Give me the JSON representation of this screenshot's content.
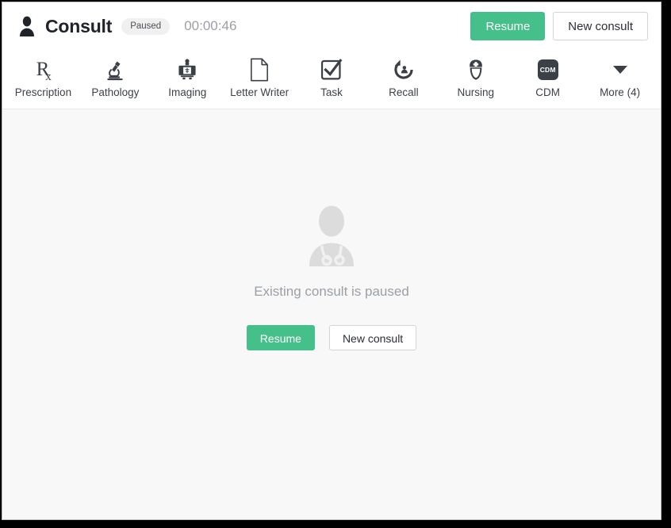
{
  "window": {
    "background_color": "#000000",
    "surface_color": "#ffffff",
    "body_color": "#f8f8f8",
    "accent_color": "#46c08a"
  },
  "header": {
    "person_icon": "person-icon",
    "title": "Consult",
    "status_badge": "Paused",
    "timer": "00:00:46",
    "actions": {
      "resume_label": "Resume",
      "new_consult_label": "New consult"
    }
  },
  "toolbar": {
    "items": [
      {
        "label": "Prescription",
        "icon": "rx-icon"
      },
      {
        "label": "Pathology",
        "icon": "microscope-icon"
      },
      {
        "label": "Imaging",
        "icon": "xray-machine-icon"
      },
      {
        "label": "Letter Writer",
        "icon": "document-page-icon"
      },
      {
        "label": "Task",
        "icon": "checkbox-checked-icon"
      },
      {
        "label": "Recall",
        "icon": "recall-person-icon"
      },
      {
        "label": "Nursing",
        "icon": "nurse-icon"
      },
      {
        "label": "CDM",
        "icon": "cdm-badge-icon",
        "badge_text": "CDM"
      },
      {
        "label": "More (4)",
        "icon": "chevron-down-icon"
      }
    ]
  },
  "main": {
    "empty_state": {
      "icon": "doctor-silhouette-icon",
      "message": "Existing consult is paused",
      "resume_label": "Resume",
      "new_consult_label": "New consult"
    }
  }
}
